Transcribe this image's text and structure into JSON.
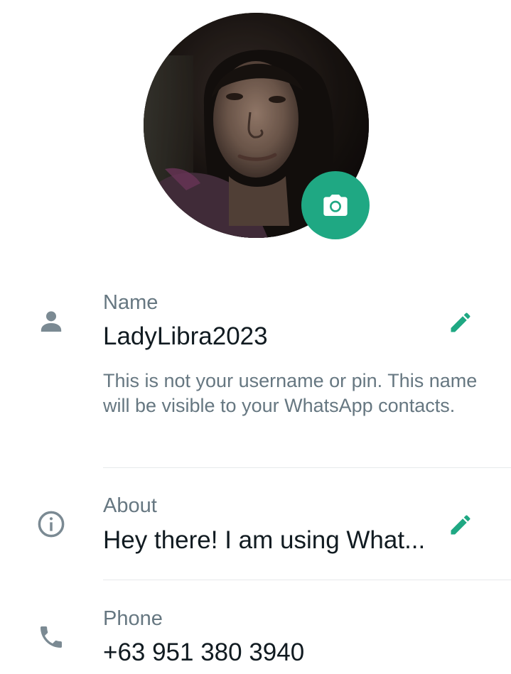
{
  "profile": {
    "photo_alt": "Profile photo"
  },
  "name_section": {
    "label": "Name",
    "value": "LadyLibra2023",
    "hint": "This is not your username or pin. This name will be visible to your WhatsApp contacts."
  },
  "about_section": {
    "label": "About",
    "value": "Hey there! I am using What..."
  },
  "phone_section": {
    "label": "Phone",
    "value": "+63 951 380 3940"
  },
  "colors": {
    "accent": "#1fa883",
    "secondary_text": "#667781",
    "icon_gray": "#7b8a93",
    "primary_text": "#111b21"
  },
  "icons": {
    "camera": "camera-icon",
    "person": "person-icon",
    "info": "info-icon",
    "phone": "phone-icon",
    "edit": "pencil-icon"
  }
}
